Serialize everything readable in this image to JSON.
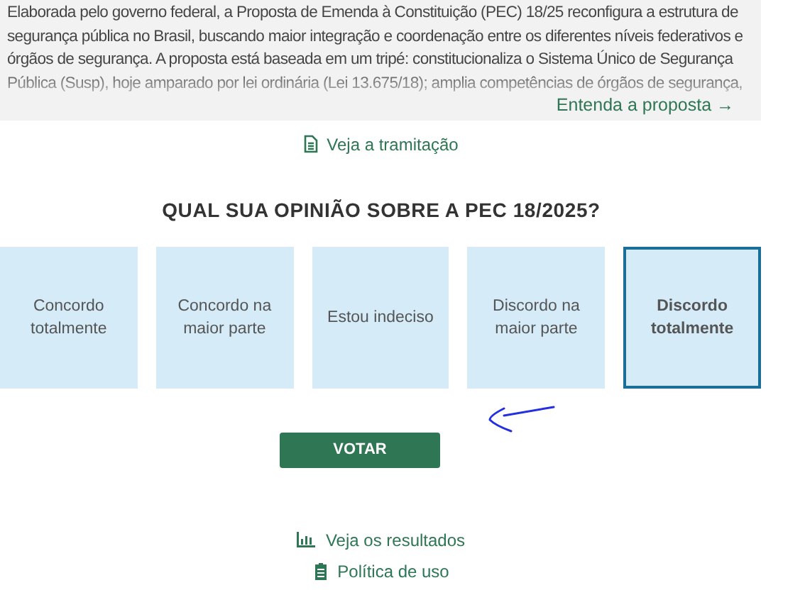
{
  "summary": {
    "text": "Elaborada pelo governo federal, a Proposta de Emenda à Constituição (PEC) 18/25 reconfigura a estrutura de segurança pública no Brasil, buscando maior integração e coordenação entre os diferentes níveis federativos e órgãos de segurança. A proposta está baseada em um tripé: constitucionaliza o Sistema Único de Segurança Pública (Susp), hoje amparado por lei ordinária (Lei 13.675/18); amplia competências de órgãos de segurança,",
    "link": "Entenda a proposta →"
  },
  "tramitacao_link": "Veja a tramitação",
  "question": "QUAL SUA OPINIÃO SOBRE A PEC 18/2025?",
  "options": [
    {
      "label": "Concordo totalmente",
      "selected": false
    },
    {
      "label": "Concordo na maior parte",
      "selected": false
    },
    {
      "label": "Estou indeciso",
      "selected": false
    },
    {
      "label": "Discordo na maior parte",
      "selected": false
    },
    {
      "label": "Discordo totalmente",
      "selected": true
    }
  ],
  "vote_button": "VOTAR",
  "footer_links": [
    {
      "kind": "results",
      "label": "Veja os resultados"
    },
    {
      "kind": "policy",
      "label": "Política de uso"
    }
  ]
}
